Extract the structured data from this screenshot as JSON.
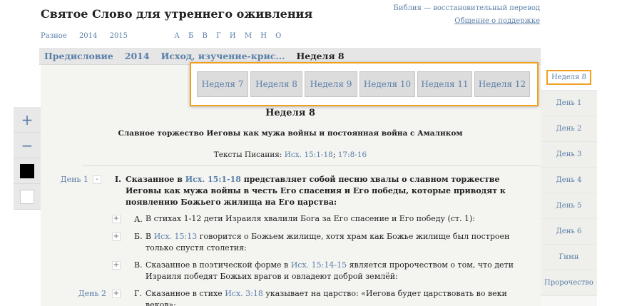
{
  "header": {
    "site_title": "Святое Слово для утреннего оживления",
    "bible_link": "Библия — восстановительный перевод",
    "support_link": "Общение о поддержке"
  },
  "nav": {
    "items": [
      "Разное",
      "2014",
      "2015"
    ],
    "letters": [
      "А",
      "Б",
      "В",
      "Г",
      "И",
      "М",
      "Н",
      "О"
    ]
  },
  "breadcrumb": {
    "items": [
      "Предисловие",
      "2014",
      "Исход, изучение-крис..."
    ],
    "current": "Неделя 8"
  },
  "week_popup": {
    "weeks": [
      "Неделя 7",
      "Неделя 8",
      "Неделя 9",
      "Неделя 10",
      "Неделя 11",
      "Неделя 12"
    ]
  },
  "side_tabs": {
    "active": "Неделя 8",
    "items": [
      "День 1",
      "День 2",
      "День 3",
      "День 4",
      "День 5",
      "День 6",
      "Гимн",
      "Пророчество"
    ]
  },
  "tools": {
    "zoom_in": "+",
    "zoom_out": "−"
  },
  "content": {
    "week_title": "Неделя 8",
    "subtitle": "Славное торжество Иеговы как мужа войны и постоянная война с Амаликом",
    "scripture_label": "Тексты Писания:",
    "scripture_ref1": "Исх. 15:1-18",
    "scripture_sep": ";",
    "scripture_ref2": "17:8-16",
    "day1_label": "День 1",
    "day2_label": "День 2",
    "collapse_symbol": "-",
    "expand_symbol": "+",
    "point1": {
      "mark": "I.",
      "pre": "Сказанное в ",
      "ref": "Исх. 15:1-18",
      "post": " представляет собой песню хвалы о славном торжестве Иеговы как мужа войны в честь Его спасения и Его победы, которые приводят к появлению Божьего жилища на Его царства:"
    },
    "subA": {
      "mark": "А.",
      "text": "В стихах 1-12 дети Израиля хвалили Бога за Его спасение и Его победу (ст. 1):"
    },
    "subB": {
      "mark": "Б.",
      "pre": "В ",
      "ref": "Исх. 15:13",
      "post": " говорится о Божьем жилище, хотя храм как Божье жилище был построен только спустя столетия:"
    },
    "subV": {
      "mark": "В.",
      "pre": "Сказанное в поэтической форме в ",
      "ref": "Исх. 15:14-15",
      "post": " является пророчеством о том, что дети Израиля победят Божьих врагов и овладеют доброй землёй:"
    },
    "subG": {
      "mark": "Г.",
      "pre": "Сказанное в стихе ",
      "ref": "Исх. 3:18",
      "post": " указывает на царство: «Иегова будет царствовать во веки веков»:"
    }
  }
}
